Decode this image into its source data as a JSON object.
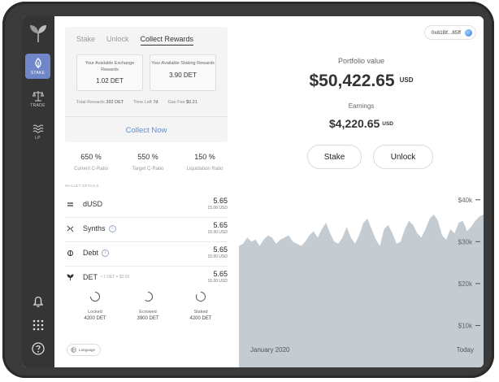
{
  "nav": {
    "items": [
      {
        "label": "STAKE",
        "icon": "leaf-icon",
        "active": true
      },
      {
        "label": "TRADE",
        "icon": "scales-icon",
        "active": false
      },
      {
        "label": "LP",
        "icon": "waves-icon",
        "active": false
      }
    ],
    "bottom_icons": [
      "bell-icon",
      "grid-icon",
      "help-icon"
    ]
  },
  "tabs": [
    "Stake",
    "Unlock",
    "Collect Rewards"
  ],
  "active_tab": "Collect Rewards",
  "rewards": {
    "exchange": {
      "label": "Your Available Exchange Rewards",
      "value": "1.02 DET"
    },
    "staking": {
      "label": "Your Available Staking Rewards",
      "value": "3.90 DET"
    }
  },
  "meta": {
    "total_rewards_label": "Total Rewards",
    "total_rewards_value": "392 DET",
    "time_left_label": "Time Left",
    "time_left_value": "7d",
    "gas_fee_label": "Gas Fee",
    "gas_fee_value": "$0.21"
  },
  "collect_button": "Collect Now",
  "ratios": [
    {
      "value": "650 %",
      "label": "Current C-Ratio"
    },
    {
      "value": "550 %",
      "label": "Target C-Ratio"
    },
    {
      "value": "150 %",
      "label": "Liquidation Ratio"
    }
  ],
  "wallet_details_label": "WALLET DETAILS",
  "wallet_rows": [
    {
      "name": "dUSD",
      "icon": "equals-icon",
      "amount": "5.65",
      "usd": "15.00 USD",
      "info": false
    },
    {
      "name": "Synths",
      "icon": "synths-icon",
      "amount": "5.65",
      "usd": "15.00 USD",
      "info": true
    },
    {
      "name": "Debt",
      "icon": "debt-icon",
      "amount": "5.65",
      "usd": "15.00 USD",
      "info": true
    },
    {
      "name": "DET",
      "icon": "det-logo-icon",
      "sub": "• 1 DET = $2.65",
      "amount": "5.65",
      "usd": "15.00 USD",
      "info": false
    }
  ],
  "det_stats": [
    {
      "label": "Locked",
      "value": "4200 DET"
    },
    {
      "label": "Ecrowed",
      "value": "3900 DET"
    },
    {
      "label": "Staked",
      "value": "4200 DET"
    }
  ],
  "language_button": "Language",
  "wallet_address": "0x81Bf...85ff",
  "portfolio": {
    "label": "Portfolio value",
    "value": "$50,422.65",
    "currency": "USD",
    "earnings_label": "Earnings",
    "earnings_value": "$4,220.65",
    "earnings_currency": "USD"
  },
  "actions": {
    "stake": "Stake",
    "unlock": "Unlock"
  },
  "chart_data": {
    "type": "area",
    "y_ticks": [
      "$40k",
      "$30k",
      "$20k",
      "$10k"
    ],
    "y_tick_values": [
      40000,
      30000,
      20000,
      10000
    ],
    "x_labels": [
      "January 2020",
      "Today"
    ],
    "ylim": [
      0,
      45000
    ],
    "values": [
      29000,
      29500,
      31000,
      30000,
      30500,
      29000,
      30500,
      31500,
      31000,
      29500,
      30500,
      31000,
      31500,
      30000,
      29500,
      29000,
      30000,
      31500,
      32500,
      31000,
      33000,
      34500,
      32000,
      30000,
      29500,
      31000,
      33500,
      31000,
      29500,
      31500,
      34500,
      35500,
      33000,
      30500,
      29000,
      33000,
      34000,
      32000,
      29500,
      30000,
      33000,
      35000,
      34000,
      32000,
      31000,
      33000,
      35500,
      36500,
      35000,
      31500,
      30500,
      33000,
      32000,
      34500,
      35000,
      32500,
      33500,
      35000,
      36000,
      36500
    ],
    "color": "#c4cbd1",
    "grid": false
  },
  "colors": {
    "accent": "#6f86c9",
    "link": "#5b8fd3"
  }
}
